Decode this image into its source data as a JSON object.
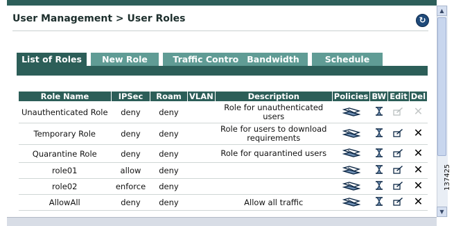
{
  "header": {
    "breadcrumb": "User Management > User Roles"
  },
  "tabs": [
    {
      "label": "List of Roles",
      "active": true
    },
    {
      "label": "New Role",
      "active": false
    },
    {
      "label": "Traffic Control",
      "active": false
    },
    {
      "label": "Bandwidth",
      "active": false
    },
    {
      "label": "Schedule",
      "active": false
    }
  ],
  "table": {
    "columns": [
      "Role Name",
      "IPSec",
      "Roam",
      "VLAN",
      "Description",
      "Policies",
      "BW",
      "Edit",
      "Del"
    ],
    "rows": [
      {
        "name": "Unauthenticated Role",
        "ipsec": "deny",
        "roam": "deny",
        "vlan": "",
        "description": "Role for unauthenticated users",
        "edit_enabled": false,
        "del_enabled": false
      },
      {
        "name": "Temporary Role",
        "ipsec": "deny",
        "roam": "deny",
        "vlan": "",
        "description": "Role for users to download requirements",
        "edit_enabled": true,
        "del_enabled": true
      },
      {
        "name": "Quarantine Role",
        "ipsec": "deny",
        "roam": "deny",
        "vlan": "",
        "description": "Role for quarantined users",
        "edit_enabled": true,
        "del_enabled": true
      },
      {
        "name": "role01",
        "ipsec": "allow",
        "roam": "deny",
        "vlan": "",
        "description": "",
        "edit_enabled": true,
        "del_enabled": true
      },
      {
        "name": "role02",
        "ipsec": "enforce",
        "roam": "deny",
        "vlan": "",
        "description": "",
        "edit_enabled": true,
        "del_enabled": true
      },
      {
        "name": "AllowAll",
        "ipsec": "deny",
        "roam": "deny",
        "vlan": "",
        "description": "Allow all traffic",
        "edit_enabled": true,
        "del_enabled": true
      }
    ]
  },
  "icons": {
    "refresh": "refresh-icon",
    "policies": "policies-icon",
    "bandwidth": "hourglass-icon",
    "edit": "edit-icon",
    "delete": "delete-icon"
  },
  "watermark": "137425",
  "colors": {
    "accent_dark": "#2c5e58",
    "accent_tab": "#609c95"
  }
}
